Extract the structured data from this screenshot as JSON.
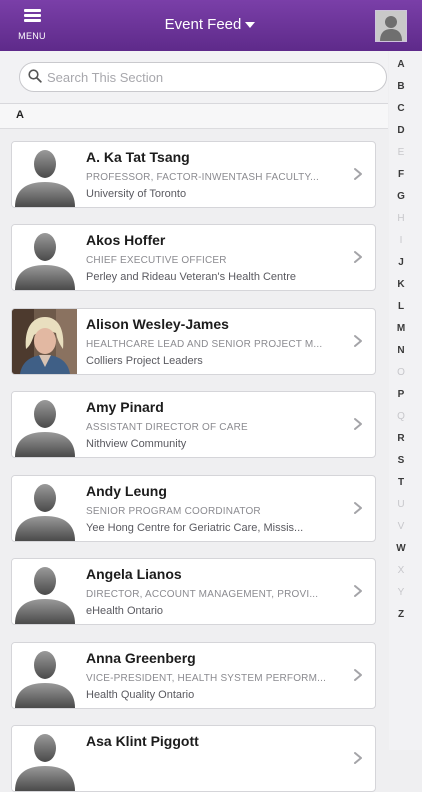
{
  "header": {
    "menu_label": "MENU",
    "title": "Event Feed",
    "brand_color": "#6b3399"
  },
  "search": {
    "placeholder": "Search This Section"
  },
  "section": {
    "letter": "A"
  },
  "index": {
    "letters": [
      "A",
      "B",
      "C",
      "D",
      "E",
      "F",
      "G",
      "H",
      "I",
      "J",
      "K",
      "L",
      "M",
      "N",
      "O",
      "P",
      "Q",
      "R",
      "S",
      "T",
      "U",
      "V",
      "W",
      "X",
      "Y",
      "Z"
    ],
    "inactive": [
      "E",
      "H",
      "I",
      "O",
      "Q",
      "U",
      "V",
      "X",
      "Y"
    ]
  },
  "contacts": [
    {
      "name": "A. Ka Tat Tsang",
      "role": "PROFESSOR, FACTOR-INWENTASH FACULTY...",
      "org": "University of Toronto",
      "photo": "placeholder"
    },
    {
      "name": "Akos Hoffer",
      "role": "CHIEF EXECUTIVE OFFICER",
      "org": "Perley and Rideau Veteran's Health Centre",
      "photo": "placeholder"
    },
    {
      "name": "Alison Wesley-James",
      "role": "HEALTHCARE LEAD AND SENIOR PROJECT M...",
      "org": "Colliers Project Leaders",
      "photo": "portrait"
    },
    {
      "name": "Amy Pinard",
      "role": "ASSISTANT DIRECTOR OF CARE",
      "org": "Nithview Community",
      "photo": "placeholder"
    },
    {
      "name": "Andy Leung",
      "role": "SENIOR PROGRAM COORDINATOR",
      "org": "Yee Hong Centre for Geriatric Care, Missis...",
      "photo": "placeholder"
    },
    {
      "name": "Angela Lianos",
      "role": "DIRECTOR, ACCOUNT MANAGEMENT, PROVI...",
      "org": "eHealth Ontario",
      "photo": "placeholder"
    },
    {
      "name": "Anna Greenberg",
      "role": "VICE-PRESIDENT, HEALTH SYSTEM PERFORM...",
      "org": "Health Quality Ontario",
      "photo": "placeholder"
    },
    {
      "name": "Asa Klint Piggott",
      "role": "",
      "org": "",
      "photo": "placeholder"
    }
  ]
}
